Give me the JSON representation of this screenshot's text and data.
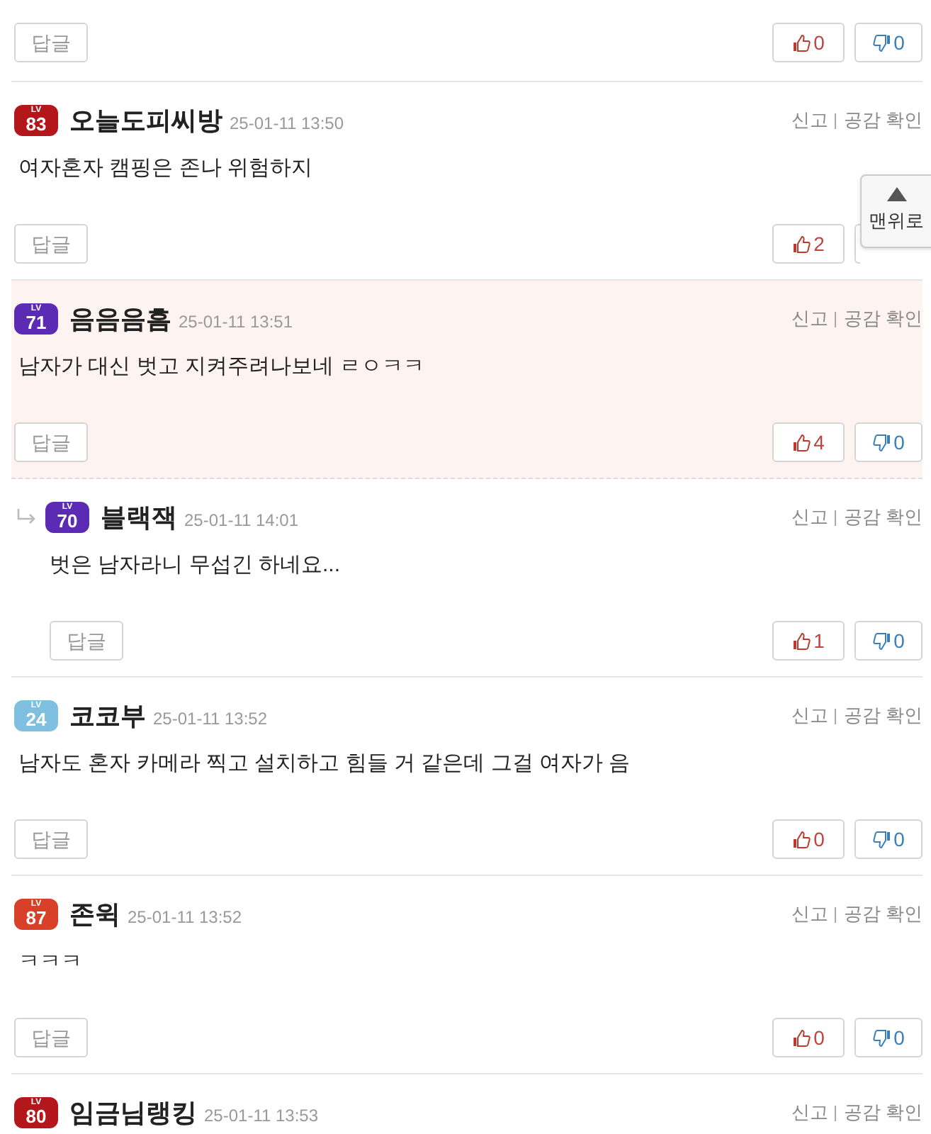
{
  "top_actions": {
    "reply": "답글",
    "likes": "0",
    "dislikes": "0"
  },
  "comments": [
    {
      "kind": "comment",
      "badge_label": "LV",
      "level": "83",
      "color": "#b3171c",
      "name": "오늘도피씨방",
      "time": "25-01-11 13:50",
      "text": "여자혼자 캠핑은 존나 위험하지",
      "report": "신고",
      "empathy": "공감 확인",
      "reply": "답글",
      "likes": "2",
      "highlighted": false
    },
    {
      "kind": "comment",
      "badge_label": "LV",
      "level": "71",
      "color": "#5b2bb5",
      "name": "음음음흠",
      "time": "25-01-11 13:51",
      "text": "남자가 대신 벗고 지켜주려나보네 ㄹㅇㅋㅋ",
      "report": "신고",
      "empathy": "공감 확인",
      "reply": "답글",
      "likes": "4",
      "dislikes": "0",
      "highlighted": true
    },
    {
      "kind": "reply",
      "badge_label": "LV",
      "level": "70",
      "color": "#5b2bb5",
      "name": "블랙잭",
      "time": "25-01-11 14:01",
      "text": "벗은 남자라니 무섭긴 하네요...",
      "report": "신고",
      "empathy": "공감 확인",
      "reply": "답글",
      "likes": "1",
      "dislikes": "0",
      "highlighted": false
    },
    {
      "kind": "comment",
      "badge_label": "LV",
      "level": "24",
      "color": "#7fbfe0",
      "name": "코코부",
      "time": "25-01-11 13:52",
      "text": "남자도 혼자 카메라 찍고 설치하고 힘들 거 같은데 그걸 여자가 음",
      "report": "신고",
      "empathy": "공감 확인",
      "reply": "답글",
      "likes": "0",
      "dislikes": "0",
      "highlighted": false
    },
    {
      "kind": "comment",
      "badge_label": "LV",
      "level": "87",
      "color": "#d8402a",
      "name": "존윅",
      "time": "25-01-11 13:52",
      "text": "ㅋㅋㅋ",
      "report": "신고",
      "empathy": "공감 확인",
      "reply": "답글",
      "likes": "0",
      "dislikes": "0",
      "highlighted": false
    },
    {
      "kind": "comment",
      "badge_label": "LV",
      "level": "80",
      "color": "#b3171c",
      "name": "임금님랭킹",
      "time": "25-01-11 13:53",
      "report": "신고",
      "empathy": "공감 확인",
      "highlighted": false
    }
  ],
  "scroll_top": {
    "label": "맨위로"
  }
}
